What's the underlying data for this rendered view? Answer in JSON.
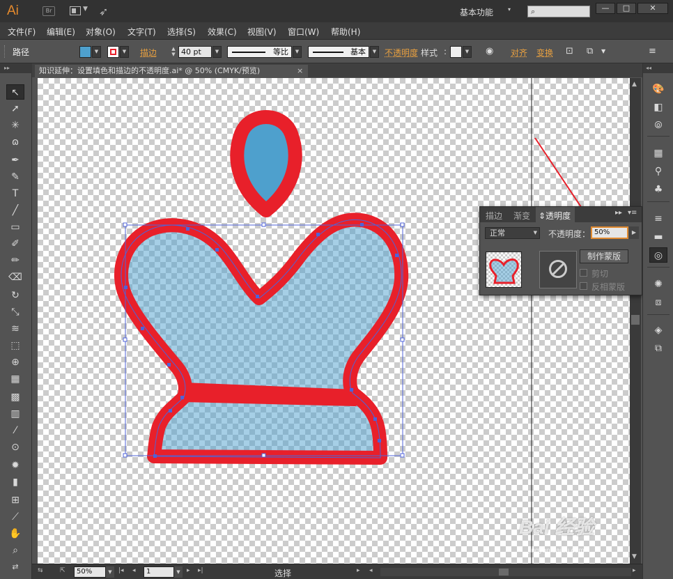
{
  "app": {
    "logo": "Ai",
    "bridge": "Br",
    "workspace": "基本功能",
    "window_buttons": [
      "—",
      "□",
      "✕"
    ]
  },
  "menu": [
    "文件(F)",
    "编辑(E)",
    "对象(O)",
    "文字(T)",
    "选择(S)",
    "效果(C)",
    "视图(V)",
    "窗口(W)",
    "帮助(H)"
  ],
  "control": {
    "object_type": "路径",
    "fill_color": "#4ea0cd",
    "stroke_color": "#e8202a",
    "stroke_label": "描边",
    "stroke_weight": "40 pt",
    "profile_label": "等比",
    "brush_label": "基本",
    "opacity_label": "不透明度",
    "style_label": "样式",
    "align_label": "对齐",
    "transform_label": "变换"
  },
  "document": {
    "tab_title": "知识延伸：设置填色和描边的不透明度.ai* @ 50% (CMYK/预览)"
  },
  "status": {
    "zoom": "50%",
    "artboard": "1",
    "mode": "选择"
  },
  "transparency_panel": {
    "tabs": [
      "描边",
      "渐变",
      "透明度"
    ],
    "active_tab": "透明度",
    "blend_mode": "正常",
    "opacity_label": "不透明度",
    "opacity_value": "50%",
    "make_mask_label": "制作蒙版",
    "clip_label": "剪切",
    "invert_mask_label": "反相蒙版"
  },
  "watermark": {
    "text": "Bai 经验",
    "sub": "jingyan.baidu.com"
  },
  "colors": {
    "accent": "#e8a040",
    "fill": "#4ea0cd",
    "stroke": "#e8202a",
    "selection": "#4f63d8"
  }
}
